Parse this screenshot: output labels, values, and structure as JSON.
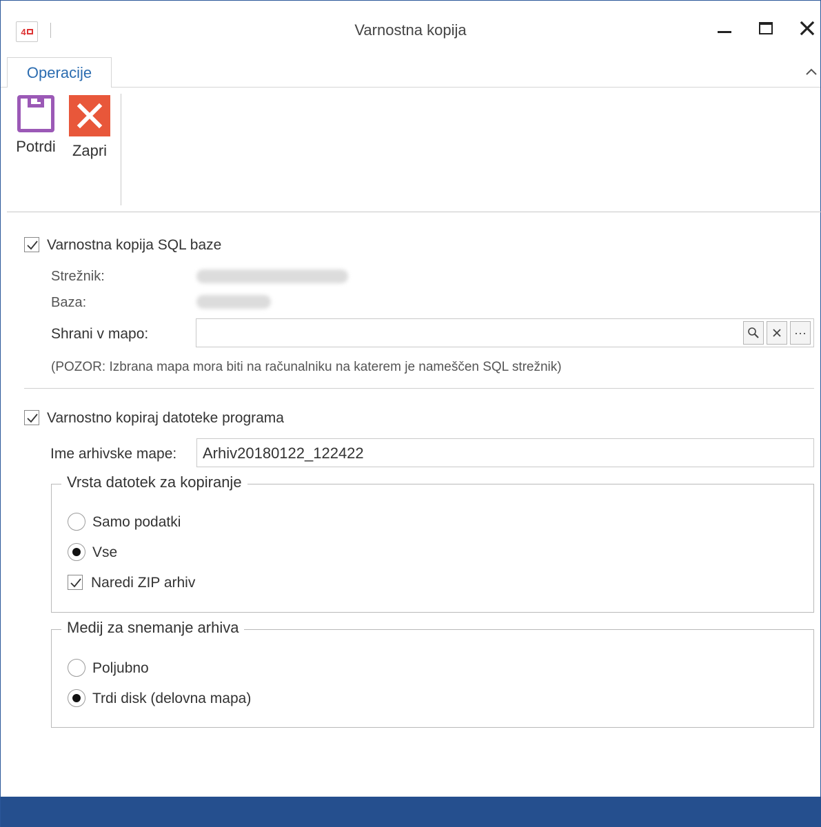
{
  "window": {
    "title": "Varnostna kopija",
    "logo_text": "4"
  },
  "ribbon": {
    "tab": "Operacije",
    "collapse_glyph": "^",
    "save_label": "Potrdi",
    "close_label": "Zapri"
  },
  "sql_backup": {
    "checkbox_label": "Varnostna kopija SQL baze",
    "checked": true,
    "server_label": "Strežnik:",
    "database_label": "Baza:",
    "folder_label": "Shrani v mapo:",
    "folder_value": "",
    "search_glyph": "🔍",
    "clear_glyph": "✕",
    "browse_glyph": "···",
    "warning": "(POZOR: Izbrana mapa mora biti na računalniku na katerem je nameščen SQL strežnik)"
  },
  "file_backup": {
    "checkbox_label": "Varnostno kopiraj datoteke programa",
    "checked": true,
    "archive_label": "Ime arhivske mape:",
    "archive_value": "Arhiv20180122_122422",
    "file_type_group": {
      "legend": "Vrsta datotek za kopiranje",
      "option_data_only": "Samo podatki",
      "option_all": "Vse",
      "selected": "Vse",
      "zip_label": "Naredi ZIP arhiv",
      "zip_checked": true
    },
    "media_group": {
      "legend": "Medij za snemanje arhiva",
      "option_any": "Poljubno",
      "option_disk": "Trdi disk (delovna mapa)",
      "selected": "Trdi disk (delovna mapa)"
    }
  },
  "colors": {
    "accent_blue": "#2b579a",
    "footer_blue": "#254f8e",
    "save_purple": "#9b59b6",
    "close_orange": "#e8573a",
    "logo_red": "#dd3333"
  }
}
